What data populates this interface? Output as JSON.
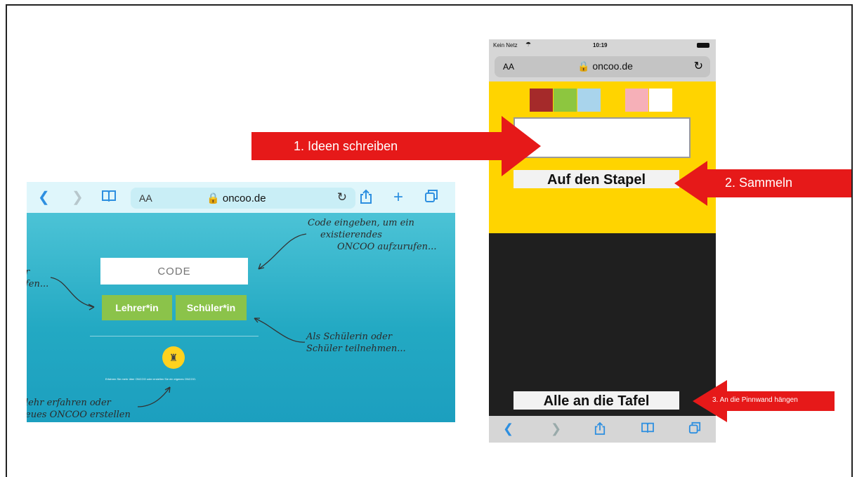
{
  "tablet": {
    "url": "oncoo.de",
    "aa": "AA",
    "code_placeholder": "CODE",
    "teacher_button": "Lehrer*in",
    "student_button": "Schüler*in",
    "note_top_right": [
      "Code eingeben, um ein",
      "existierendes",
      "ONCOO aufzurufen..."
    ],
    "note_left_partial": [
      "r",
      "fen..."
    ],
    "note_student": [
      "Als Schülerin oder",
      "Schüler teilnehmen..."
    ],
    "note_bottom_left": [
      "lehr erfahren oder",
      "eues ONCOO erstellen"
    ],
    "tiny_text": "Erfahren Sie mehr über ONCOO oder erstellen Sie ein eigenes ONCOO."
  },
  "phone": {
    "carrier": "Kein Netz",
    "time": "10:19",
    "aa": "AA",
    "url": "oncoo.de",
    "swatch_colors": [
      "#a52a2a",
      "#8dc63f",
      "#a9d4ec",
      "#ffd400",
      "#f6b0b8",
      "#ffffff"
    ],
    "stack_button": "Auf den Stapel",
    "board_button": "Alle an die Tafel"
  },
  "arrows": {
    "step1": "1. Ideen schreiben",
    "step2": "2. Sammeln",
    "step3": "3. An die Pinnwand hängen",
    "color": "#e61919"
  }
}
